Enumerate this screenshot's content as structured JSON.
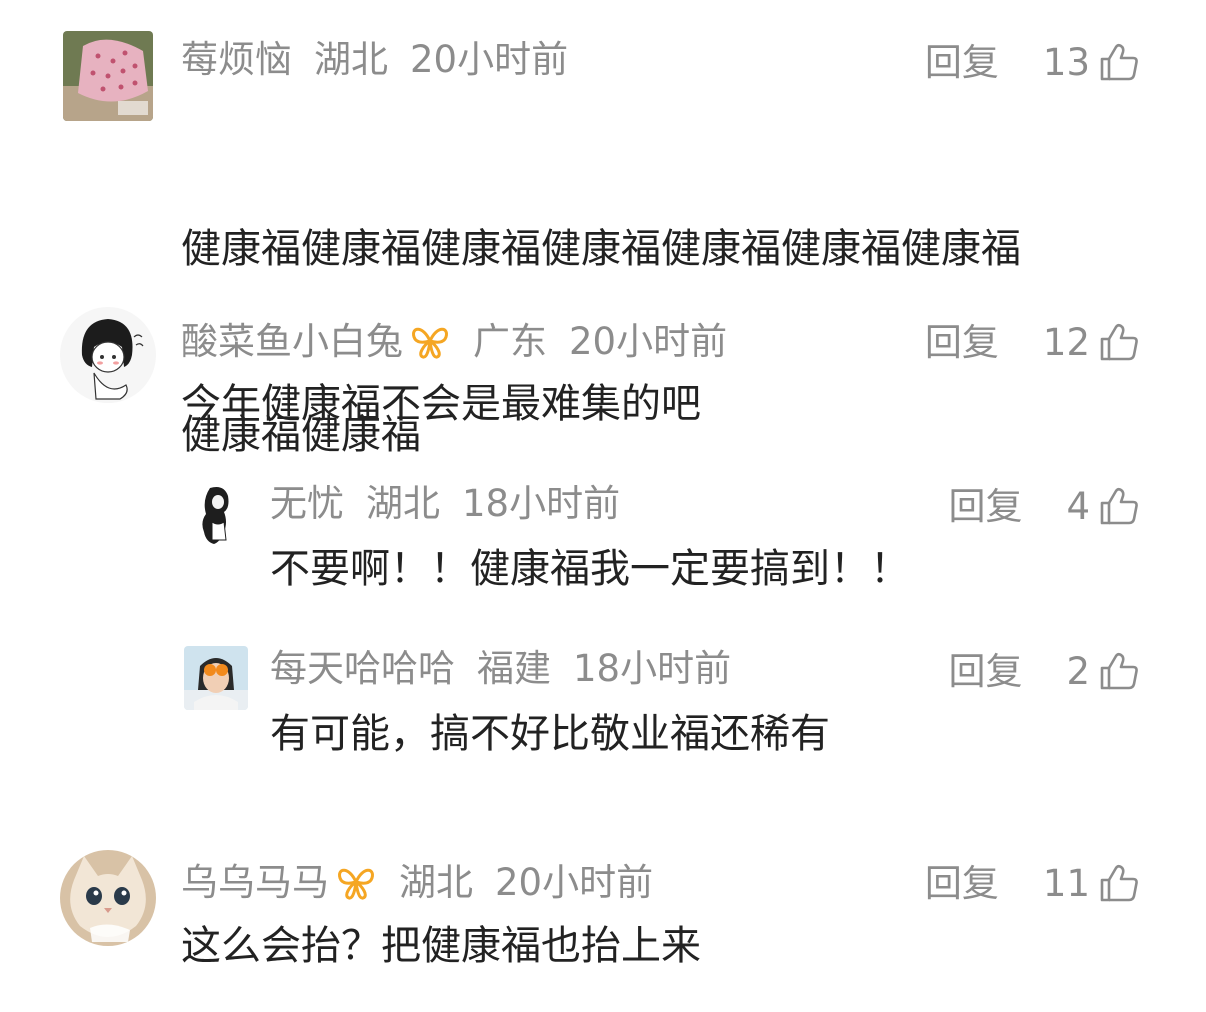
{
  "comments": [
    {
      "user": "莓烦恼",
      "location": "湖北",
      "time": "20小时前",
      "reply_label": "回复",
      "likes": "13",
      "text_line1": "健康福健康福健康福健康福健康福健康福健康福",
      "text_line2": "健康福健康福",
      "avatar": "pink-cloth-avatar"
    },
    {
      "user": "酸菜鱼小白兔",
      "location": "广东",
      "time": "20小时前",
      "reply_label": "回复",
      "likes": "12",
      "text": "今年健康福不会是最难集的吧",
      "avatar": "cartoon-girl-avatar",
      "badge": "vip-butterfly-icon"
    },
    {
      "user": "无忧",
      "location": "湖北",
      "time": "18小时前",
      "reply_label": "回复",
      "likes": "4",
      "text": "不要啊！！健康福我一定要搞到！！",
      "avatar": "sketch-girl-avatar"
    },
    {
      "user": "每天哈哈哈",
      "location": "福建",
      "time": "18小时前",
      "reply_label": "回复",
      "likes": "2",
      "text": "有可能，搞不好比敬业福还稀有",
      "avatar": "orange-eyes-avatar"
    },
    {
      "user": "乌乌马马",
      "location": "湖北",
      "time": "20小时前",
      "reply_label": "回复",
      "likes": "11",
      "text": "这么会抬？把健康福也抬上来",
      "avatar": "cat-avatar",
      "badge": "vip-butterfly-icon"
    }
  ],
  "colors": {
    "meta_text": "#8c8c8c",
    "body_text": "#222222",
    "badge": "#f5a623",
    "background": "#ffffff"
  }
}
